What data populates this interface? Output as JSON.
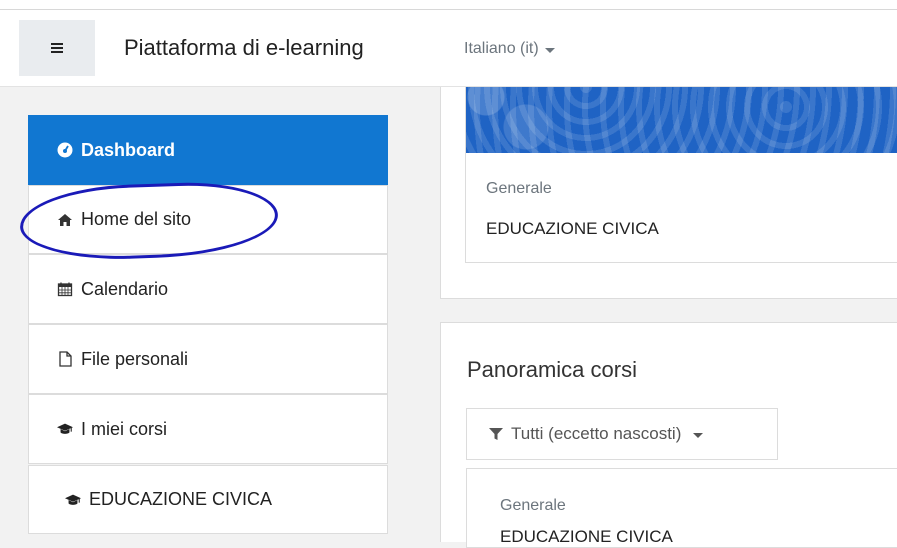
{
  "header": {
    "brand": "Piattaforma di e-learning",
    "language": "Italiano (it)"
  },
  "sidebar": {
    "items": [
      {
        "label": "Dashboard",
        "icon": "dashboard-icon",
        "active": true
      },
      {
        "label": "Home del sito",
        "icon": "home-icon"
      },
      {
        "label": "Calendario",
        "icon": "calendar-icon"
      },
      {
        "label": "File personali",
        "icon": "file-icon"
      },
      {
        "label": "I miei corsi",
        "icon": "graduation-cap-icon"
      },
      {
        "label": "EDUCAZIONE CIVICA",
        "icon": "graduation-cap-icon"
      }
    ]
  },
  "recent_course": {
    "category": "Generale",
    "name": "EDUCAZIONE CIVICA"
  },
  "overview": {
    "title": "Panoramica corsi",
    "filter_label": "Tutti (eccetto nascosti)",
    "course": {
      "category": "Generale",
      "name": "EDUCAZIONE CIVICA"
    }
  },
  "colors": {
    "accent": "#1177d1",
    "banner": "#1f63c4",
    "annotation": "#1a1ab8"
  }
}
